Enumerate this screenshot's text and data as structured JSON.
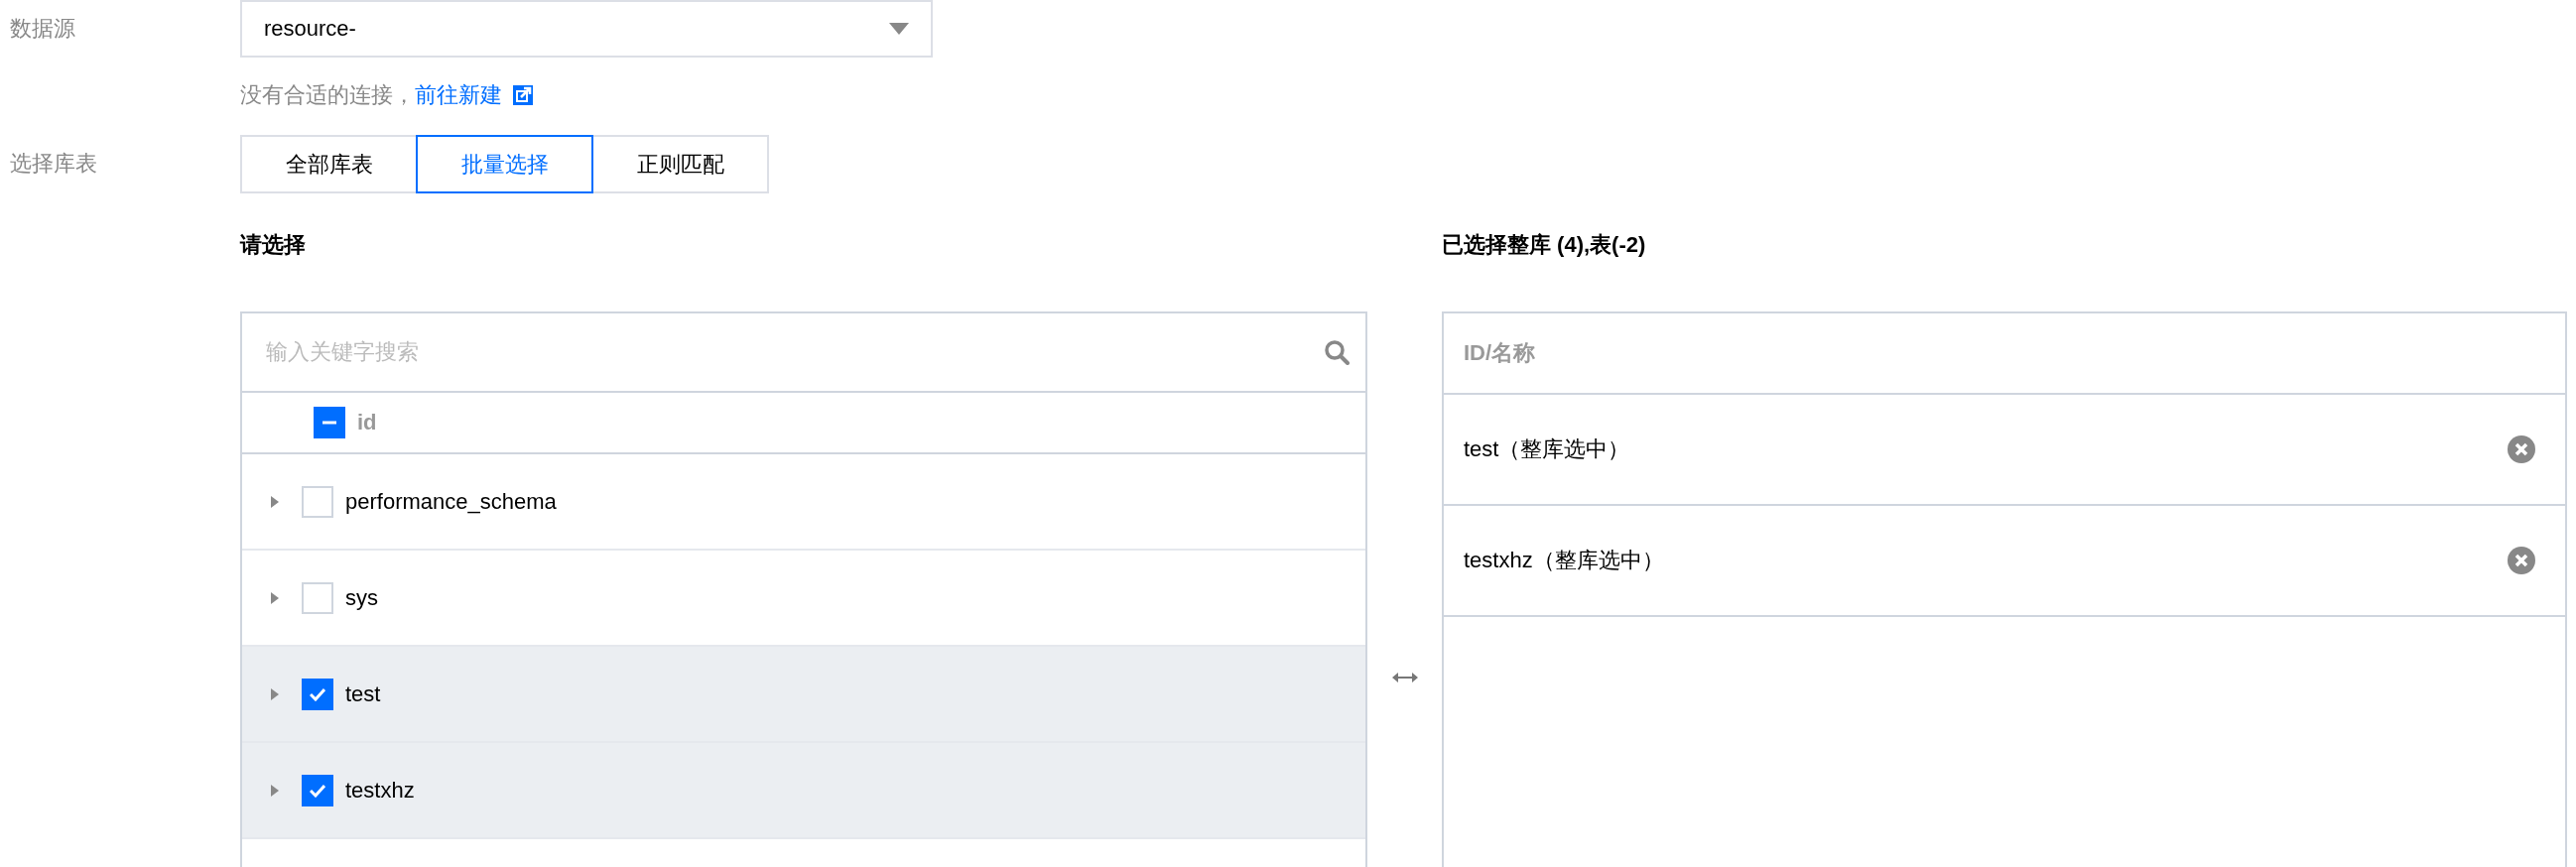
{
  "datasource": {
    "label": "数据源",
    "value": "resource-",
    "hint": "没有合适的连接，",
    "link": "前往新建"
  },
  "table_select": {
    "label": "选择库表",
    "modes": [
      {
        "label": "全部库表",
        "selected": false
      },
      {
        "label": "批量选择",
        "selected": true
      },
      {
        "label": "正则匹配",
        "selected": false
      }
    ]
  },
  "source_panel": {
    "title": "请选择",
    "search": {
      "placeholder": "输入关键字搜索"
    },
    "header": {
      "label": "id",
      "checked": true,
      "indeterminate": true
    },
    "rows": [
      {
        "name": "performance_schema",
        "checked": false,
        "expanded": false
      },
      {
        "name": "sys",
        "checked": false,
        "expanded": false
      },
      {
        "name": "test",
        "checked": true,
        "expanded": false
      },
      {
        "name": "testxhz",
        "checked": true,
        "expanded": false
      }
    ]
  },
  "selected_panel": {
    "title": "已选择整库 (4),表(-2)",
    "header": "ID/名称",
    "items": [
      {
        "name": "test（整库选中）"
      },
      {
        "name": "testxhz（整库选中）"
      }
    ]
  }
}
